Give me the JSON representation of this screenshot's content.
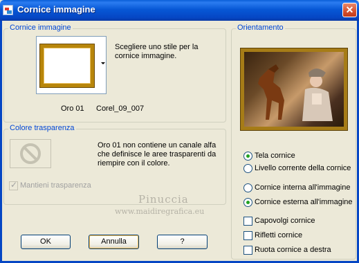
{
  "window": {
    "title": "Cornice immagine",
    "close_symbol": "✕"
  },
  "frame_group": {
    "legend": "Cornice immagine",
    "description": "Scegliere uno stile per la cornice immagine.",
    "style_name": "Oro 01",
    "file_name": "Corel_09_007"
  },
  "transparency_group": {
    "legend": "Colore trasparenza",
    "message": "Oro 01 non contiene un canale alfa che definisce le aree trasparenti da riempire con il colore.",
    "keep_transparency_label": "Mantieni trasparenza",
    "keep_transparency_checked": true
  },
  "orientation_group": {
    "legend": "Orientamento",
    "canvas_options": [
      {
        "label": "Tela cornice",
        "selected": true
      },
      {
        "label": "Livello corrente della cornice",
        "selected": false
      }
    ],
    "placement_options": [
      {
        "label": "Cornice interna all'immagine",
        "selected": false
      },
      {
        "label": "Cornice esterna all'immagine",
        "selected": true
      }
    ],
    "checkboxes": [
      {
        "label": "Capovolgi cornice",
        "checked": false
      },
      {
        "label": "Rifletti cornice",
        "checked": false
      },
      {
        "label": "Ruota cornice a destra",
        "checked": false
      }
    ]
  },
  "buttons": {
    "ok": "OK",
    "cancel": "Annulla",
    "help": "?"
  },
  "watermark": {
    "title": "Pinuccia",
    "url": "www.maidiregrafica.eu"
  },
  "colors": {
    "title_bar": "#0546c4",
    "legend_text": "#0046d5",
    "radio_selected": "#21a121",
    "frame_gold": "#b8860b"
  }
}
